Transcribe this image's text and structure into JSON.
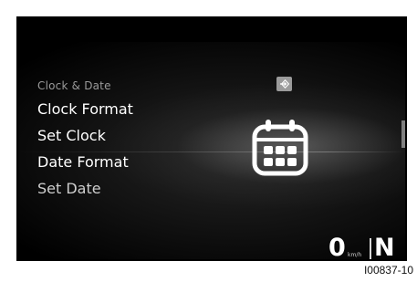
{
  "menu": {
    "header": "Clock & Date",
    "items": [
      {
        "label": "Clock Format",
        "dim": false
      },
      {
        "label": "Set Clock",
        "dim": false
      },
      {
        "label": "Date Format",
        "dim": false
      },
      {
        "label": "Set Date",
        "dim": true
      }
    ]
  },
  "icons": {
    "enter": "enter-arrow-icon",
    "calendar": "calendar-icon"
  },
  "status": {
    "speed": "0",
    "unit": "km/h",
    "gear": "N"
  },
  "caption": "I00837-10",
  "colors": {
    "screen_bg": "#000000",
    "text": "#ffffff",
    "header_text": "#9a9a9a",
    "button_bg": "#9b9b9b"
  }
}
